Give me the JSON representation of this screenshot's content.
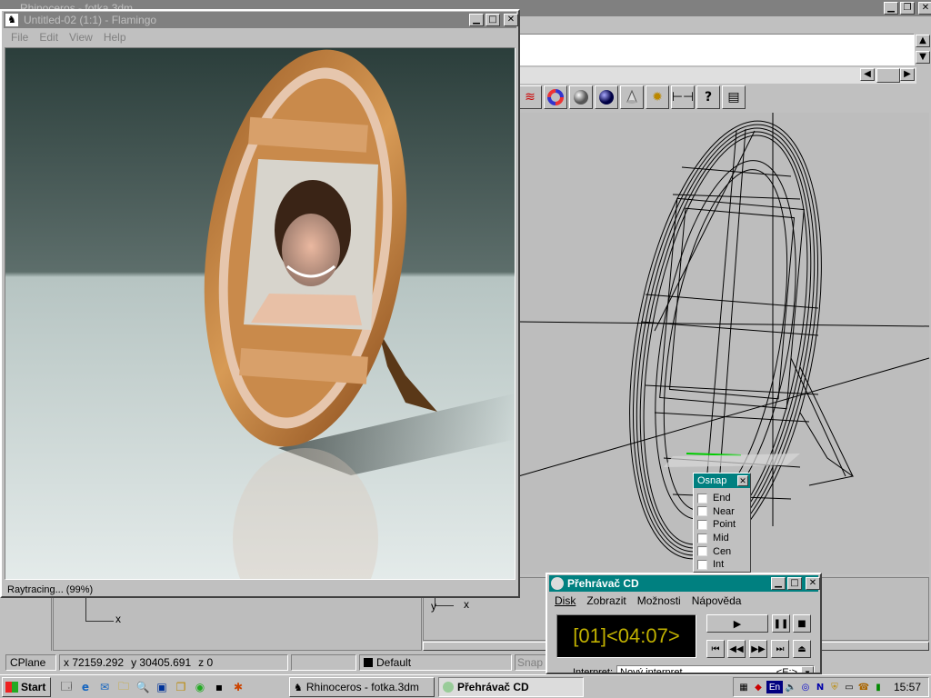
{
  "rhino": {
    "title": "Rhinoceros - fotka.3dm",
    "statusbar": {
      "cplane": "CPlane",
      "x": "x 72159.292",
      "y": "y 30405.691",
      "z": "z 0",
      "layer": "Default",
      "snap": "Snap"
    },
    "viewport_labels": {
      "axis_x": "x",
      "axis_y": "y"
    },
    "toolbar_icons": [
      "layers-icon",
      "color-wheel-icon",
      "gray-sphere-icon",
      "blue-sphere-icon",
      "cone-light-icon",
      "gear-icon",
      "dimension-icon",
      "help-icon",
      "properties-icon"
    ]
  },
  "flamingo": {
    "title": "Untitled-02  (1:1) - Flamingo",
    "menu": [
      "File",
      "Edit",
      "View",
      "Help"
    ],
    "status": "Raytracing... (99%)"
  },
  "osnap": {
    "title": "Osnap",
    "items": [
      {
        "label": "End",
        "checked": false
      },
      {
        "label": "Near",
        "checked": false
      },
      {
        "label": "Point",
        "checked": false
      },
      {
        "label": "Mid",
        "checked": false
      },
      {
        "label": "Cen",
        "checked": false
      },
      {
        "label": "Int",
        "checked": false
      }
    ]
  },
  "cdplayer": {
    "title": "Přehrávač CD",
    "menu": [
      "Disk",
      "Zobrazit",
      "Možnosti",
      "Nápověda"
    ],
    "display": "[01]<04:07>",
    "artist_label": "Interpret:",
    "artist_value": "Nový interpret",
    "drive": "<E:>"
  },
  "taskbar": {
    "start": "Start",
    "tasks": [
      {
        "label": "Rhinoceros - fotka.3dm",
        "active": false
      },
      {
        "label": "Přehrávač CD",
        "active": true
      }
    ],
    "tray_lang": "En",
    "clock": "15:57"
  }
}
